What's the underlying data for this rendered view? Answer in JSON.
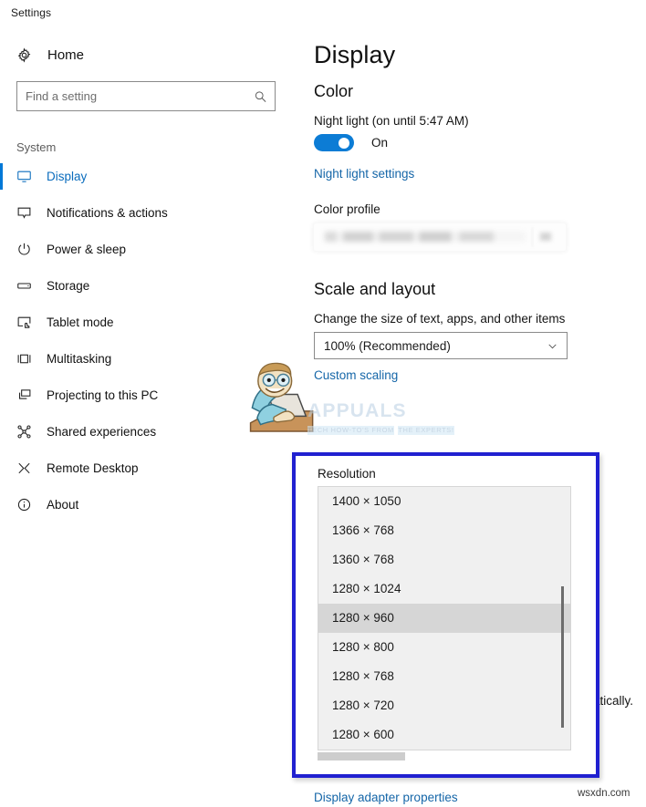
{
  "window": {
    "title": "Settings"
  },
  "sidebar": {
    "home": {
      "label": "Home",
      "icon": "gear-icon"
    },
    "search": {
      "value": "",
      "placeholder": "Find a setting",
      "icon": "search-icon"
    },
    "group_title": "System",
    "items": [
      {
        "label": "Display",
        "icon": "monitor-icon",
        "selected": true
      },
      {
        "label": "Notifications & actions",
        "icon": "speech-bubble-icon",
        "selected": false
      },
      {
        "label": "Power & sleep",
        "icon": "power-icon",
        "selected": false
      },
      {
        "label": "Storage",
        "icon": "drive-icon",
        "selected": false
      },
      {
        "label": "Tablet mode",
        "icon": "tablet-touch-icon",
        "selected": false
      },
      {
        "label": "Multitasking",
        "icon": "windows-pane-icon",
        "selected": false
      },
      {
        "label": "Projecting to this PC",
        "icon": "project-screen-icon",
        "selected": false
      },
      {
        "label": "Shared experiences",
        "icon": "share-nodes-icon",
        "selected": false
      },
      {
        "label": "Remote Desktop",
        "icon": "remote-desktop-icon",
        "selected": false
      },
      {
        "label": "About",
        "icon": "info-circle-icon",
        "selected": false
      }
    ]
  },
  "main": {
    "page_title": "Display",
    "color_section": {
      "title": "Color",
      "night_light_label": "Night light (on until 5:47 AM)",
      "night_light_state": "On",
      "night_light_settings_link": "Night light settings",
      "color_profile_label": "Color profile",
      "color_profile_value": ""
    },
    "scale_section": {
      "title": "Scale and layout",
      "scale_label": "Change the size of text, apps, and other items",
      "scale_value": "100% (Recommended)",
      "custom_scaling_link": "Custom scaling"
    },
    "resolution_popup": {
      "label": "Resolution",
      "options": [
        "1400 × 1050",
        "1366 × 768",
        "1360 × 768",
        "1280 × 1024",
        "1280 × 960",
        "1280 × 800",
        "1280 × 768",
        "1280 × 720",
        "1280 × 600"
      ],
      "selected": "1280 × 960",
      "highlight_color": "#2020d0"
    },
    "clipped_text": "utomatically.",
    "adapter_link": "Display adapter properties"
  },
  "watermarks": {
    "brand_big": "APPUALS",
    "brand_line1": "TECH HOW-TO'S FROM",
    "brand_line2": "THE EXPERTS!",
    "site": "wsxdn.com"
  },
  "colors": {
    "accent": "#0078d7",
    "link": "#1566a8",
    "toggle_on": "#0c7cd5",
    "highlight_border": "#2020d0"
  }
}
